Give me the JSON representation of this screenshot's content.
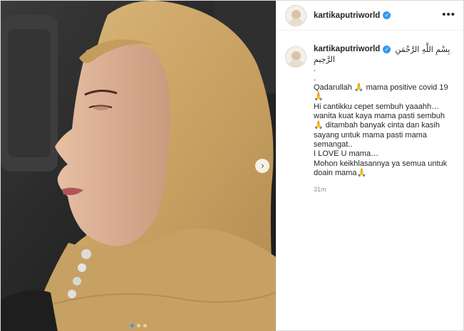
{
  "account": {
    "username": "kartikaputriworld",
    "verified_glyph": "✓"
  },
  "header": {
    "more_glyph": "•••"
  },
  "media": {
    "next_glyph": "›",
    "carousel_dots": 3,
    "active_dot": 0,
    "accent_color": "#3897f0"
  },
  "caption": {
    "arabic_line1": "بِسْمِ اللَّهِ الرَّحْمَنِ",
    "arabic_line2": "الرَّحِيمِ",
    "lines": [
      {
        "text": ".",
        "pray": false
      },
      {
        "text": ".",
        "pray": false
      },
      {
        "text": "Qadarullah 🙏 mama positive covid 19🙏",
        "pray": false
      },
      {
        "text": "Hi cantikku cepet sembuh yaaahh… wanita kuat kaya mama pasti sembuh 🙏 ditambah banyak cinta dan kasih sayang untuk mama pasti mama semangat..",
        "pray": false
      },
      {
        "text": "I LOVE U mama…",
        "pray": false
      },
      {
        "text": "Mohon keikhlasannya ya semua untuk doain mama🙏",
        "pray": false
      }
    ],
    "timestamp": "31m"
  }
}
